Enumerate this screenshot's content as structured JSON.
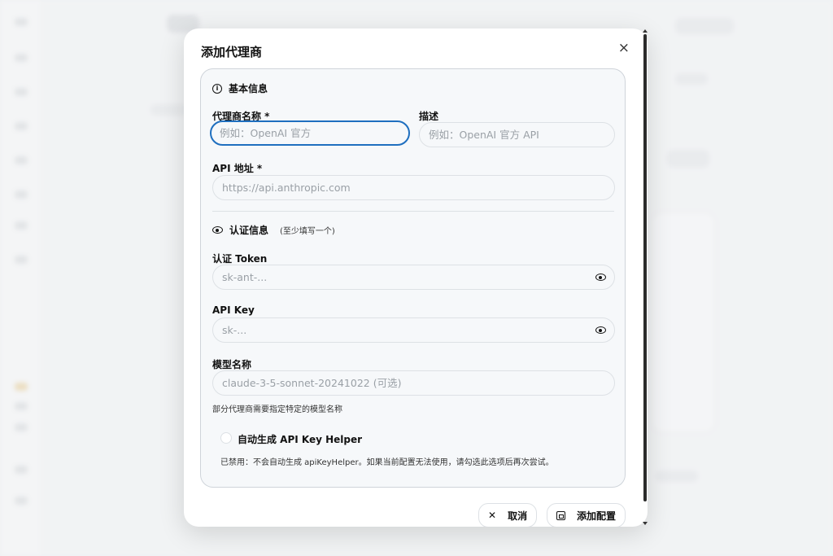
{
  "modal": {
    "title": "添加代理商",
    "close": "×"
  },
  "basic": {
    "header": "基本信息",
    "info_icon": "i",
    "name_label": "代理商名称 *",
    "name_placeholder": "例如：OpenAI 官方",
    "desc_label": "描述",
    "desc_placeholder": "例如：OpenAI 官方 API",
    "api_label": "API 地址 *",
    "api_placeholder": "https://api.anthropic.com"
  },
  "auth": {
    "header": "认证信息",
    "note": "(至少填写一个)",
    "token_label": "认证 Token",
    "token_placeholder": "sk-ant-...",
    "key_label": "API Key",
    "key_placeholder": "sk-...",
    "model_label": "模型名称",
    "model_placeholder": "claude-3-5-sonnet-20241022 (可选)",
    "model_hint": "部分代理商需要指定特定的模型名称",
    "helper_label": "自动生成 API Key Helper",
    "helper_hint": "已禁用：不会自动生成 apiKeyHelper。如果当前配置无法使用，请勾选此选项后再次尝试。",
    "helper_checked": false
  },
  "footer": {
    "cancel_icon": "✕",
    "cancel": "取消",
    "submit": "添加配置"
  },
  "colors": {
    "focus_ring": "#1f6fbf",
    "section_bg": "#f6f8fa"
  }
}
